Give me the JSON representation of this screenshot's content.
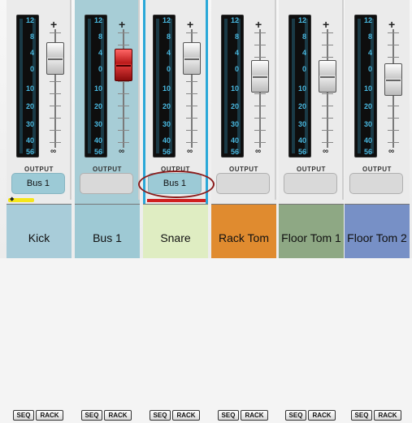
{
  "meter_scale": [
    "12",
    "8",
    "4",
    "0",
    "10",
    "20",
    "30",
    "40",
    "56"
  ],
  "fader_top_symbol": "+",
  "fader_bottom_symbol": "∞",
  "output_label": "OUTPUT",
  "seq_label": "SEQ",
  "rack_label": "RACK",
  "colors": {
    "accent": "#2aa8d8",
    "annotation": "#8b1d1d",
    "meter_text": "#49b8e0"
  },
  "channels": [
    {
      "name": "Kick",
      "output": "Bus 1",
      "fader_level": 0.55,
      "fader_red": false
    },
    {
      "name": "Bus 1",
      "output": "",
      "fader_level": 0.62,
      "fader_red": true
    },
    {
      "name": "Snare",
      "output": "Bus 1",
      "fader_level": 0.55,
      "fader_red": false
    },
    {
      "name": "Rack Tom",
      "output": "",
      "fader_level": 0.38,
      "fader_red": false
    },
    {
      "name": "Floor Tom 1",
      "output": "",
      "fader_level": 0.38,
      "fader_red": false
    },
    {
      "name": "Floor Tom 2",
      "output": "",
      "fader_level": 0.38,
      "fader_red": false
    }
  ]
}
